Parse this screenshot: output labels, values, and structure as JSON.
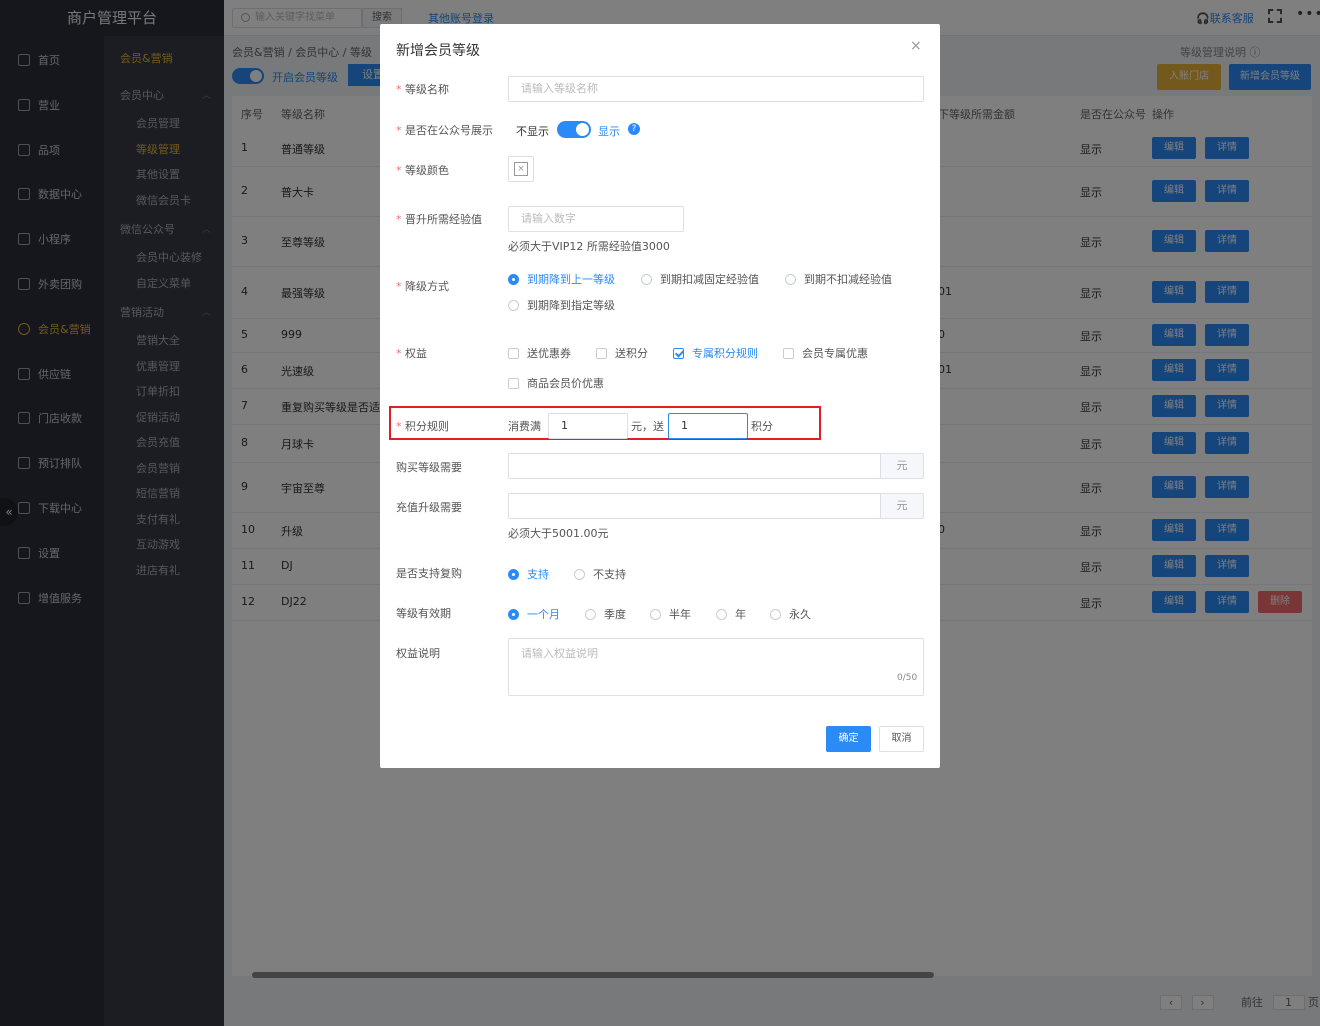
{
  "app": {
    "title": "商户管理平台"
  },
  "sidebar": {
    "items": [
      {
        "label": "首页",
        "icon": "home-icon"
      },
      {
        "label": "营业",
        "icon": "calendar-icon"
      },
      {
        "label": "品项",
        "icon": "bag-icon"
      },
      {
        "label": "数据中心",
        "icon": "share-icon"
      },
      {
        "label": "小程序",
        "icon": "phone-icon"
      },
      {
        "label": "外卖团购",
        "icon": "bike-icon"
      },
      {
        "label": "会员&营销",
        "icon": "user-icon",
        "active": true
      },
      {
        "label": "供应链",
        "icon": "truck-icon"
      },
      {
        "label": "门店收款",
        "icon": "coins-icon"
      },
      {
        "label": "预订排队",
        "icon": "clock-icon"
      },
      {
        "label": "下载中心",
        "icon": "download-icon"
      },
      {
        "label": "设置",
        "icon": "gear-icon"
      },
      {
        "label": "增值服务",
        "icon": "alarm-icon"
      }
    ],
    "collapse_icon": "double-chevron-left-icon"
  },
  "subnav": {
    "title": "会员&营销",
    "groups": [
      {
        "label": "会员中心",
        "items": [
          "会员管理",
          "等级管理",
          "其他设置",
          "微信会员卡"
        ]
      },
      {
        "label": "微信公众号",
        "items": [
          "会员中心装修",
          "自定义菜单"
        ]
      },
      {
        "label": "营销活动",
        "items": [
          "营销大全",
          "优惠管理",
          "订单折扣",
          "促销活动",
          "会员充值",
          "会员营销",
          "短信营销",
          "支付有礼",
          "互动游戏",
          "进店有礼"
        ]
      }
    ],
    "active": "等级管理"
  },
  "topbar": {
    "search_placeholder": "输入关键字找菜单",
    "search_button": "搜索",
    "other_login": "其他账号登录",
    "contact": "联系客服",
    "more": "•••"
  },
  "page": {
    "breadcrumb": "会员&营销  /  会员中心  /  等级",
    "help_link": "等级管理说明 ⓘ",
    "toggle_label": "开启会员等级",
    "set_button": "设置",
    "join_store_button": "入账门店",
    "add_level_button": "新增会员等级"
  },
  "table": {
    "headers": {
      "no": "序号",
      "name": "等级名称",
      "amount": "下等级所需金额",
      "show": "是否在公众号",
      "ops": "操作"
    },
    "rows": [
      {
        "no": "1",
        "name": "普通等级",
        "amount": "",
        "show": "显示",
        "delete": false
      },
      {
        "no": "2",
        "name": "普大卡",
        "amount": "",
        "show": "显示",
        "delete": false
      },
      {
        "no": "3",
        "name": "至尊等级",
        "amount": "",
        "show": "显示",
        "delete": false
      },
      {
        "no": "4",
        "name": "最强等级",
        "amount": "01",
        "show": "显示",
        "delete": false
      },
      {
        "no": "5",
        "name": "999",
        "amount": "0",
        "show": "显示",
        "delete": false
      },
      {
        "no": "6",
        "name": "光速级",
        "amount": "01",
        "show": "显示",
        "delete": false
      },
      {
        "no": "7",
        "name": "重复购买等级是否适",
        "amount": "",
        "show": "显示",
        "delete": false
      },
      {
        "no": "8",
        "name": "月球卡",
        "amount": "",
        "show": "显示",
        "delete": false
      },
      {
        "no": "9",
        "name": "宇宙至尊",
        "amount": "",
        "show": "显示",
        "delete": false
      },
      {
        "no": "10",
        "name": "升级",
        "amount": "0",
        "show": "显示",
        "delete": false
      },
      {
        "no": "11",
        "name": "DJ",
        "amount": "",
        "show": "显示",
        "delete": false
      },
      {
        "no": "12",
        "name": "DJ22",
        "amount": "",
        "show": "显示",
        "delete": true
      }
    ],
    "edit_label": "编辑",
    "detail_label": "详情",
    "delete_label": "删除"
  },
  "pager": {
    "goto": "前往",
    "page": "1",
    "page_suffix": "页"
  },
  "modal": {
    "title": "新增会员等级",
    "close": "×",
    "fields": {
      "name": {
        "label": "等级名称",
        "placeholder": "请输入等级名称"
      },
      "show": {
        "label": "是否在公众号展示",
        "off": "不显示",
        "on": "显示"
      },
      "color": {
        "label": "等级颜色",
        "value": "×"
      },
      "exp": {
        "label": "晋升所需经验值",
        "placeholder": "请输入数字",
        "hint": "必须大于VIP12 所需经验值3000"
      },
      "downgrade": {
        "label": "降级方式",
        "options": [
          "到期降到上一等级",
          "到期扣减固定经验值",
          "到期不扣减经验值",
          "到期降到指定等级"
        ],
        "selected": 0
      },
      "rights": {
        "label": "权益",
        "options": [
          "送优惠券",
          "送积分",
          "专属积分规则",
          "会员专属优惠",
          "商品会员价优惠"
        ],
        "checked": [
          2
        ]
      },
      "points": {
        "label": "积分规则",
        "prefix": "消费满",
        "spend": "1",
        "mid": "元，送",
        "give": "1",
        "suffix": "积分"
      },
      "buy": {
        "label": "购买等级需要",
        "unit": "元"
      },
      "recharge": {
        "label": "充值升级需要",
        "unit": "元",
        "hint": "必须大于5001.00元"
      },
      "rebuy": {
        "label": "是否支持复购",
        "options": [
          "支持",
          "不支持"
        ],
        "selected": 0
      },
      "validity": {
        "label": "等级有效期",
        "options": [
          "一个月",
          "季度",
          "半年",
          "年",
          "永久"
        ],
        "selected": 0
      },
      "desc": {
        "label": "权益说明",
        "placeholder": "请输入权益说明",
        "counter": "0/50"
      }
    },
    "ok": "确定",
    "cancel": "取消"
  },
  "colors": {
    "primary": "#2a8af6",
    "accent": "#e8b33a",
    "danger": "#f56c6c",
    "highlight": "#e02020"
  }
}
